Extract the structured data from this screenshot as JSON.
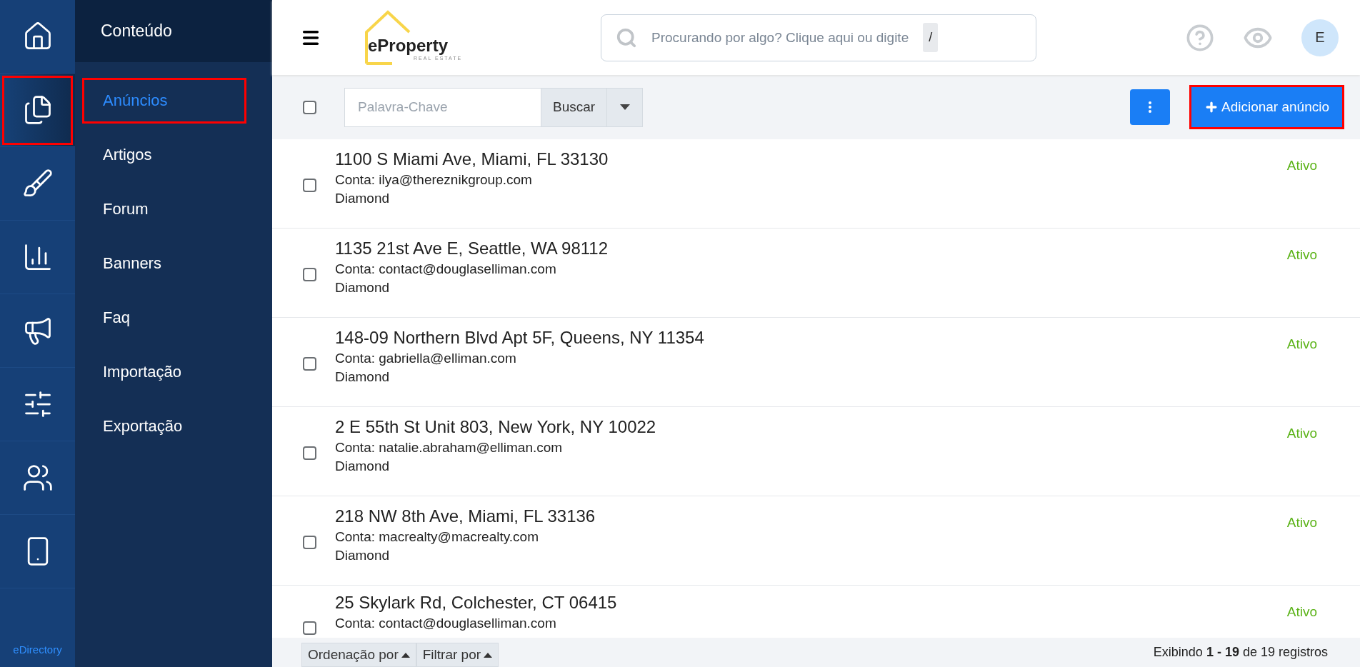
{
  "rail": {
    "items": [
      {
        "kind": "home",
        "selected": false,
        "highlighted": false
      },
      {
        "kind": "content",
        "selected": true,
        "highlighted": true
      },
      {
        "kind": "design",
        "selected": false,
        "highlighted": false
      },
      {
        "kind": "reports",
        "selected": false,
        "highlighted": false
      },
      {
        "kind": "promote",
        "selected": false,
        "highlighted": false
      },
      {
        "kind": "settings",
        "selected": false,
        "highlighted": false
      },
      {
        "kind": "users",
        "selected": false,
        "highlighted": false
      },
      {
        "kind": "mobile",
        "selected": false,
        "highlighted": false
      }
    ],
    "brand": "eDirectory"
  },
  "sidebar": {
    "title": "Conteúdo",
    "items": [
      {
        "label": "Anúncios",
        "selected": true,
        "highlighted": true
      },
      {
        "label": "Artigos",
        "selected": false,
        "highlighted": false
      },
      {
        "label": "Forum",
        "selected": false,
        "highlighted": false
      },
      {
        "label": "Banners",
        "selected": false,
        "highlighted": false
      },
      {
        "label": "Faq",
        "selected": false,
        "highlighted": false
      },
      {
        "label": "Importação",
        "selected": false,
        "highlighted": false
      },
      {
        "label": "Exportação",
        "selected": false,
        "highlighted": false
      }
    ]
  },
  "header": {
    "logo": {
      "name": "eProperty",
      "tagline": "REAL ESTATE"
    },
    "search": {
      "placeholder": "Procurando por algo? Clique aqui ou digite",
      "shortcut": "/"
    },
    "avatar": "E"
  },
  "toolbar": {
    "select_all": false,
    "keyword": {
      "placeholder": "Palavra-Chave"
    },
    "search_button": "Buscar",
    "add_button": {
      "label": "Adicionar anúncio",
      "highlighted": true
    }
  },
  "listings": [
    {
      "address": "1100 S Miami Ave, Miami, FL 33130",
      "account": "Conta: ilya@thereznikgroup.com",
      "plan": "Diamond",
      "status": "Ativo",
      "checked": false
    },
    {
      "address": "1135 21st Ave E, Seattle, WA 98112",
      "account": "Conta: contact@douglaselliman.com",
      "plan": "Diamond",
      "status": "Ativo",
      "checked": false
    },
    {
      "address": "148-09 Northern Blvd Apt 5F, Queens, NY 11354",
      "account": "Conta: gabriella@elliman.com",
      "plan": "Diamond",
      "status": "Ativo",
      "checked": false
    },
    {
      "address": "2 E 55th St Unit 803, New York, NY 10022",
      "account": "Conta: natalie.abraham@elliman.com",
      "plan": "Diamond",
      "status": "Ativo",
      "checked": false
    },
    {
      "address": "218 NW 8th Ave, Miami, FL 33136",
      "account": "Conta: macrealty@macrealty.com",
      "plan": "Diamond",
      "status": "Ativo",
      "checked": false
    },
    {
      "address": "25 Skylark Rd, Colchester, CT 06415",
      "account": "Conta: contact@douglaselliman.com",
      "status": "Ativo",
      "checked": false
    }
  ],
  "footer": {
    "sort": "Ordenação por",
    "filter": "Filtrar por",
    "summary": "Exibindo **1 - 19** de 19 registros"
  }
}
